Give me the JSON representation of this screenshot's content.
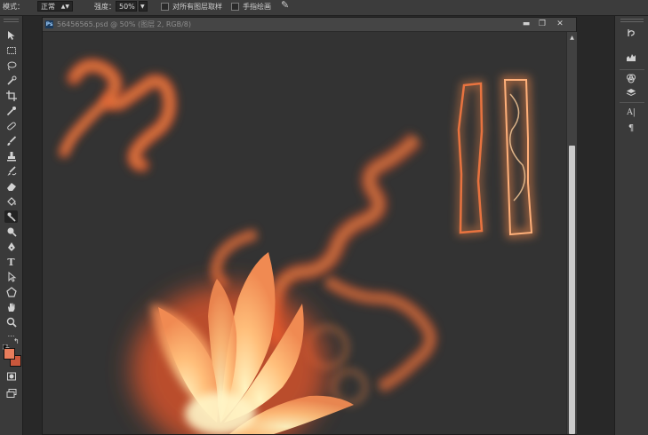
{
  "options": {
    "mode_label": "模式：",
    "mode_value": "正常",
    "strength_label": "强度：",
    "strength_value": "50%",
    "sample_all_layers": "对所有图层取样",
    "finger_painting": "手指绘画"
  },
  "document": {
    "app_badge": "Ps",
    "title": "56456565.psd @ 50% (图层 2, RGB/8)"
  },
  "icons": {
    "tools": [
      "move-tool-icon",
      "marquee-tool-icon",
      "lasso-tool-icon",
      "quick-selection-tool-icon",
      "crop-tool-icon",
      "eyedropper-tool-icon",
      "spot-healing-brush-icon",
      "brush-tool-icon",
      "clone-stamp-icon",
      "history-brush-icon",
      "eraser-tool-icon",
      "paint-bucket-icon",
      "smudge-tool-icon",
      "dodge-tool-icon",
      "pen-tool-icon",
      "type-tool-icon",
      "path-selection-tool-icon",
      "rectangle-tool-icon",
      "hand-tool-icon",
      "zoom-tool-icon"
    ],
    "panels": [
      "history-panel-icon",
      "histogram-panel-icon",
      "channels-panel-icon",
      "character-panel-icon",
      "paragraph-panel-icon"
    ]
  },
  "colors": {
    "foreground": "#e87d5c",
    "background": "#c9573c",
    "fire_core": "#fff2b0",
    "fire_mid": "#ff9a50",
    "fire_edge": "#e8562a"
  }
}
